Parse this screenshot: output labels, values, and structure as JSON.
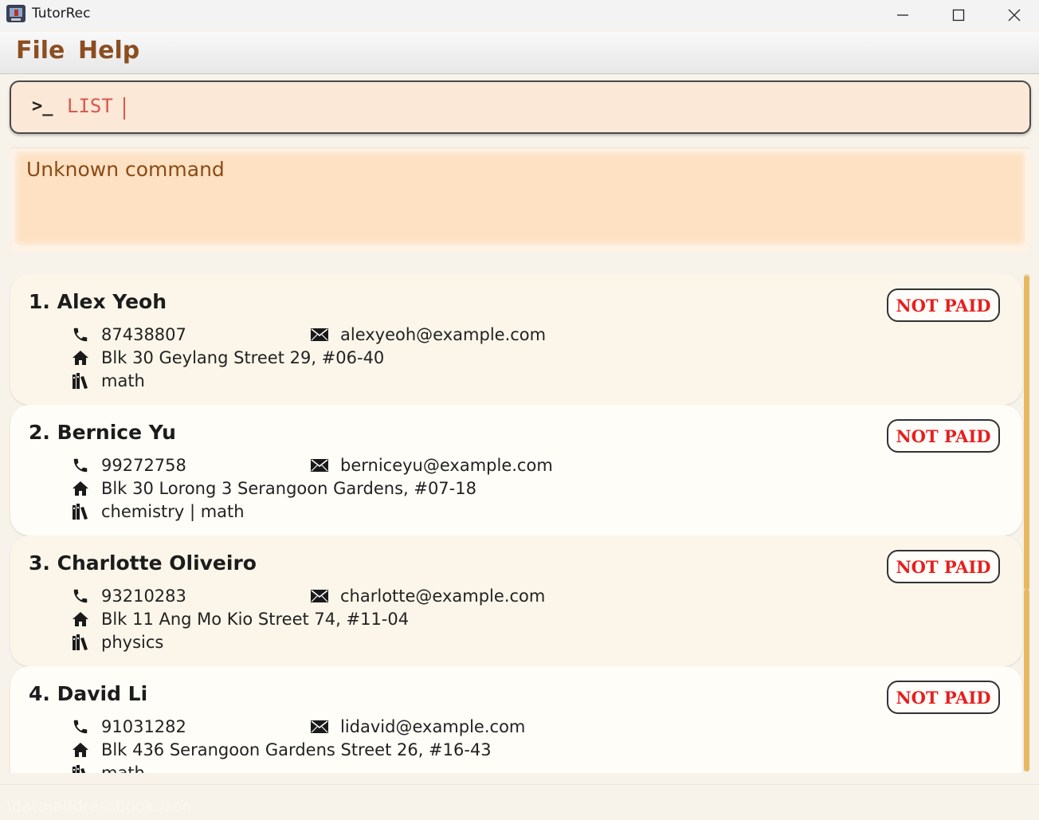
{
  "window": {
    "title": "TutorRec",
    "minimize_icon": "minimize-icon",
    "maximize_icon": "maximize-icon",
    "close_icon": "close-icon"
  },
  "menu": {
    "file": "File",
    "help": "Help"
  },
  "command": {
    "prompt": ">_",
    "value": "LIST"
  },
  "result": {
    "text": "Unknown command"
  },
  "status": {
    "text": "\\data\\addressbook.json"
  },
  "colors": {
    "accent": "#8b4e21",
    "badge_text": "#e61f1f",
    "command_text": "#d9574e"
  },
  "persons": [
    {
      "name": "1. Alex Yeoh",
      "badge": "NOT PAID",
      "phone": "87438807",
      "email": "alexyeoh@example.com",
      "address": "Blk 30 Geylang Street 29, #06-40",
      "subjects": "math"
    },
    {
      "name": "2. Bernice Yu",
      "badge": "NOT PAID",
      "phone": "99272758",
      "email": "berniceyu@example.com",
      "address": "Blk 30 Lorong 3 Serangoon Gardens, #07-18",
      "subjects": "chemistry | math"
    },
    {
      "name": "3. Charlotte Oliveiro",
      "badge": "NOT PAID",
      "phone": "93210283",
      "email": "charlotte@example.com",
      "address": "Blk 11 Ang Mo Kio Street 74, #11-04",
      "subjects": "physics"
    },
    {
      "name": "4. David Li",
      "badge": "NOT PAID",
      "phone": "91031282",
      "email": "lidavid@example.com",
      "address": "Blk 436 Serangoon Gardens Street 26, #16-43",
      "subjects": "math"
    }
  ]
}
